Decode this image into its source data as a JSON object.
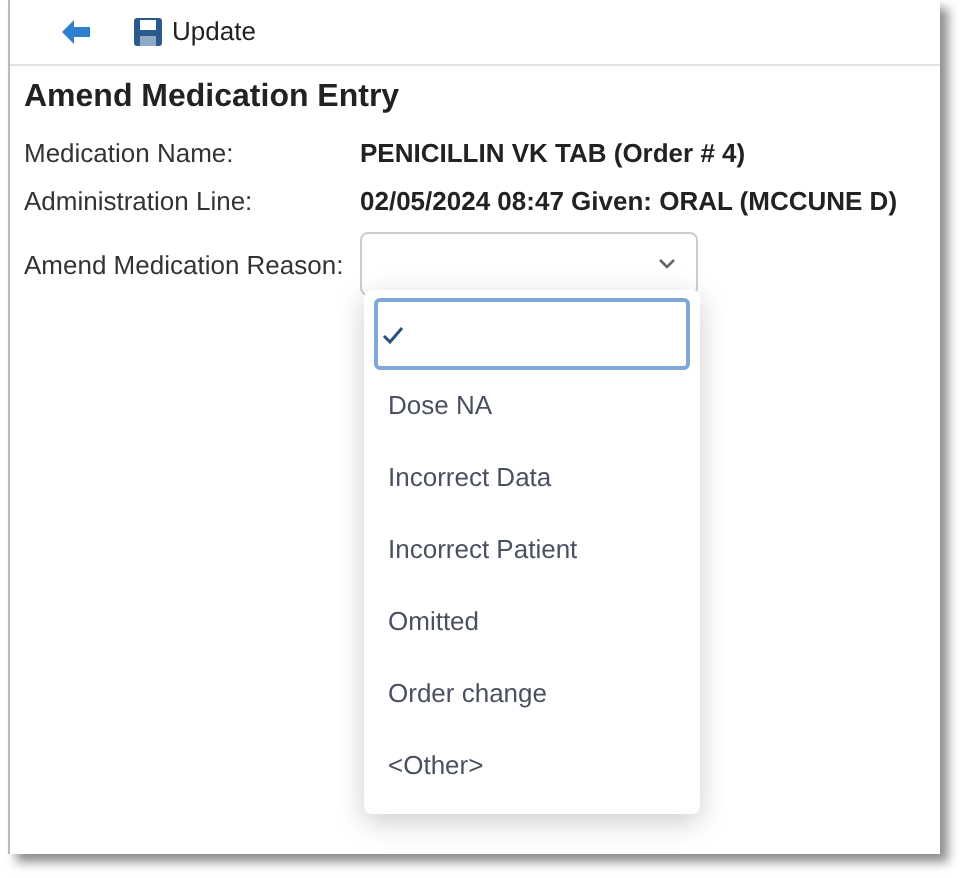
{
  "toolbar": {
    "buttons": [
      {
        "kind": "back"
      },
      {
        "kind": "save",
        "label": "Update"
      }
    ]
  },
  "title": "Amend Medication Entry",
  "fields": [
    {
      "label": "Medication Name:",
      "value": "PENICILLIN VK TAB (Order # 4)"
    },
    {
      "label": "Administration Line:",
      "value": "02/05/2024 08:47 Given: ORAL (MCCUNE D)"
    }
  ],
  "reason": {
    "label": "Amend Medication Reason:",
    "expanded": true,
    "options": [
      {
        "selected": true
      },
      {
        "label": "Dose NA",
        "selected": false
      },
      {
        "label": "Incorrect Data",
        "selected": false
      },
      {
        "label": "Incorrect Patient",
        "selected": false
      },
      {
        "label": "Omitted",
        "selected": false
      },
      {
        "label": "Order change",
        "selected": false
      },
      {
        "label": "<Other>",
        "selected": false
      }
    ]
  }
}
